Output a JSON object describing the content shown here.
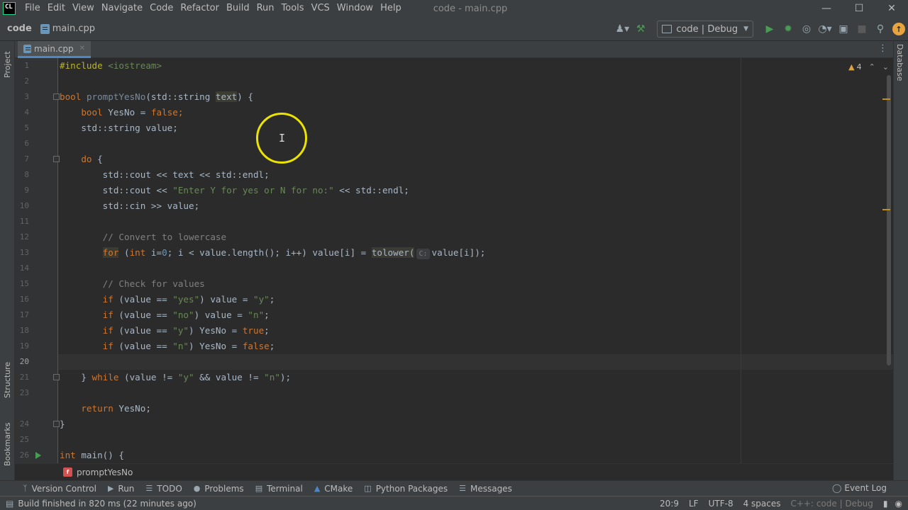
{
  "window": {
    "logo_text": "CL",
    "title": "code - main.cpp",
    "menu": [
      "File",
      "Edit",
      "View",
      "Navigate",
      "Code",
      "Refactor",
      "Build",
      "Run",
      "Tools",
      "VCS",
      "Window",
      "Help"
    ]
  },
  "navbar": {
    "project": "code",
    "file": "main.cpp",
    "run_config": "code | Debug"
  },
  "tabs": [
    {
      "label": "main.cpp",
      "active": true
    }
  ],
  "side_tabs": {
    "left_top": "Project",
    "left_mid": "Structure",
    "left_bottom": "Bookmarks",
    "right": "Database"
  },
  "editor": {
    "warnings_count": "4",
    "lines": [
      {
        "n": "1"
      },
      {
        "n": "2"
      },
      {
        "n": "3"
      },
      {
        "n": "4"
      },
      {
        "n": "5"
      },
      {
        "n": "6"
      },
      {
        "n": "7"
      },
      {
        "n": "8"
      },
      {
        "n": "9"
      },
      {
        "n": "10"
      },
      {
        "n": "11"
      },
      {
        "n": "12"
      },
      {
        "n": "13"
      },
      {
        "n": "14"
      },
      {
        "n": "15"
      },
      {
        "n": "16"
      },
      {
        "n": "17"
      },
      {
        "n": "18"
      },
      {
        "n": "19"
      },
      {
        "n": "20"
      },
      {
        "n": "21"
      },
      {
        "n": "23"
      },
      {
        "n": "24"
      },
      {
        "n": "25"
      },
      {
        "n": "26"
      }
    ],
    "code": {
      "l1_directive": "#include",
      "l1_header": "<iostream>",
      "l3_bool": "bool",
      "l3_fn": "promptYesNo",
      "l3_params_a": "(std::string ",
      "l3_param": "text",
      "l3_params_b": ") {",
      "l4_type": "bool",
      "l4_rest": " YesNo = ",
      "l4_val": "false",
      "l4_end": ";",
      "l5": "std::string value;",
      "l7_kw": "do",
      "l7_rest": " {",
      "l8": "std::cout << text << std::endl;",
      "l9_a": "std::cout << ",
      "l9_str": "\"Enter Y for yes or N for no:\"",
      "l9_b": " << std::endl;",
      "l10": "std::cin >> value;",
      "l12": "// Convert to lowercase",
      "l13_for": "for",
      "l13_a": " (",
      "l13_int": "int",
      "l13_b": " i=",
      "l13_zero": "0",
      "l13_c": "; i < value.length(); i++) value[i] = ",
      "l13_fn": "tolower(",
      "l13_hint": "C:",
      "l13_d": "value[i]);",
      "l15": "// Check for values",
      "l16_if": "if",
      "l16_a": " (value == ",
      "l16_s1": "\"yes\"",
      "l16_b": ") value = ",
      "l16_s2": "\"y\"",
      "l16_c": ";",
      "l17_if": "if",
      "l17_a": " (value == ",
      "l17_s1": "\"no\"",
      "l17_b": ") value = ",
      "l17_s2": "\"n\"",
      "l17_c": ";",
      "l18_if": "if",
      "l18_a": " (value == ",
      "l18_s1": "\"y\"",
      "l18_b": ") YesNo = ",
      "l18_val": "true",
      "l18_c": ";",
      "l19_if": "if",
      "l19_a": " (value == ",
      "l19_s1": "\"n\"",
      "l19_b": ") YesNo = ",
      "l19_val": "false",
      "l19_c": ";",
      "l21_a": "} ",
      "l21_kw": "while",
      "l21_b": " (value != ",
      "l21_s1": "\"y\"",
      "l21_c": " && value != ",
      "l21_s2": "\"n\"",
      "l21_d": ");",
      "l23_kw": "return",
      "l23_rest": " YesNo;",
      "l24": "}",
      "l26_kw": "int",
      "l26_rest": " main() {"
    }
  },
  "breadcrumb": {
    "badge": "f",
    "function": "promptYesNo"
  },
  "tool_windows": [
    "Version Control",
    "Run",
    "TODO",
    "Problems",
    "Terminal",
    "CMake",
    "Python Packages",
    "Messages"
  ],
  "event_log": "Event Log",
  "status": {
    "message": "Build finished in 820 ms (22 minutes ago)",
    "position": "20:9",
    "line_sep": "LF",
    "encoding": "UTF-8",
    "indent": "4 spaces",
    "context": "C++: code | Debug"
  },
  "colors": {
    "accent": "#4a88c7",
    "keyword": "#cc7832",
    "string": "#6a8759",
    "number": "#6897bb",
    "comment": "#808080",
    "warning": "#be9117"
  }
}
